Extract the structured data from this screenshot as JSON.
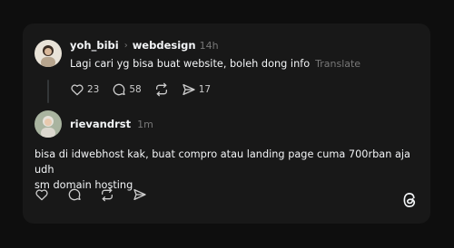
{
  "post": {
    "username": "yoh_bibi",
    "community": "webdesign",
    "time": "14h",
    "text": "Lagi cari yg bisa buat website, boleh dong info",
    "translate_label": "Translate",
    "likes": "23",
    "replies": "58",
    "shares": "17"
  },
  "reply": {
    "username": "rievandrst",
    "time": "1m",
    "text_line1": "bisa di idwebhost kak, buat compro atau landing page cuma 700rban aja udh",
    "text_line2": "sm domain hosting"
  },
  "icons": {
    "like": "heart-icon",
    "reply": "comment-icon",
    "repost": "repost-icon",
    "share": "send-icon",
    "logo": "threads-logo-icon"
  },
  "colors": {
    "background": "#0e0e0e",
    "card": "#181818",
    "text": "#f3f5f7",
    "muted": "#777777"
  }
}
